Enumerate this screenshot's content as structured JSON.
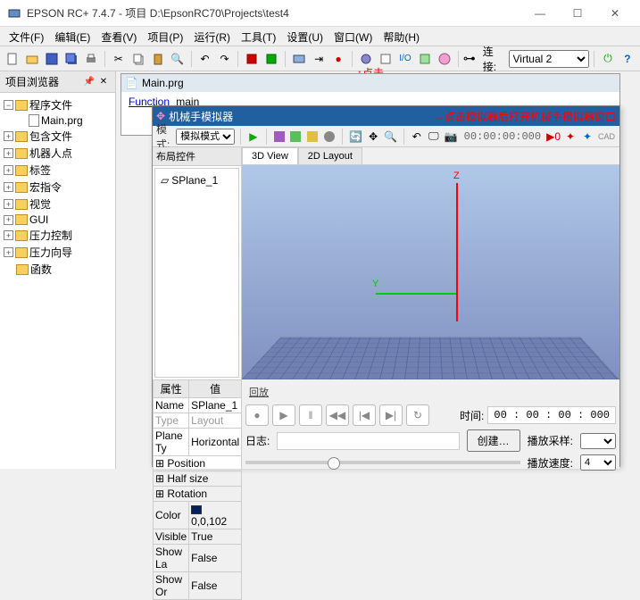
{
  "window": {
    "title": "EPSON RC+ 7.4.7 - 项目 D:\\EpsonRC70\\Projects\\test4"
  },
  "menu": [
    "文件(F)",
    "编辑(E)",
    "查看(V)",
    "项目(P)",
    "运行(R)",
    "工具(T)",
    "设置(U)",
    "窗口(W)",
    "帮助(H)"
  ],
  "conn": {
    "label": "连接:",
    "value": "Virtual 2"
  },
  "annotations": {
    "click": "↑点击",
    "simhint": "←点击模拟器后打开机械手模拟器窗口"
  },
  "sidebar": {
    "title": "项目浏览器",
    "tree": {
      "root": "程序文件",
      "mainfile": "Main.prg",
      "items": [
        "包含文件",
        "机器人点",
        "标签",
        "宏指令",
        "视觉",
        "GUI",
        "压力控制",
        "压力向导",
        "函数"
      ]
    }
  },
  "code": {
    "file": "Main.prg",
    "kw": "Function",
    "name": "main"
  },
  "sim": {
    "title": "机械手模拟器",
    "modeLabel": "模式:",
    "modeValue": "模拟模式",
    "timer": "00:00:00:000",
    "speedIcon": "▶0",
    "tabs": [
      "3D View",
      "2D Layout"
    ],
    "layoutTitle": "布局控件",
    "layoutItem": "SPlane_1",
    "prop": {
      "hdr1": "属性",
      "hdr2": "值",
      "name_l": "Name",
      "name_v": "SPlane_1",
      "type_l": "Type",
      "type_v": "Layout",
      "plane_l": "Plane Ty",
      "plane_v": "Horizontal",
      "pos_l": "Position",
      "half_l": "Half size",
      "rot_l": "Rotation",
      "color_l": "Color",
      "color_v": "0,0,102",
      "vis_l": "Visible",
      "vis_v": "True",
      "sla_l": "Show La",
      "sla_v": "False",
      "sor_l": "Show Or",
      "sor_v": "False"
    },
    "playback": {
      "title": "回放",
      "timelabel": "时间:",
      "timevalue": "00 : 00 : 00 : 000",
      "loglabel": "日志:",
      "createbtn": "创建…",
      "samplelabel": "播放采样:",
      "speedlabel": "播放速度:",
      "speedvalue": "4"
    }
  }
}
